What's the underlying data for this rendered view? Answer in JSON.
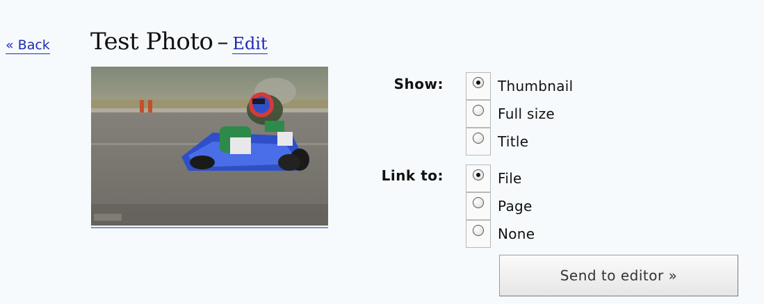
{
  "nav": {
    "back_label": "« Back"
  },
  "header": {
    "title": "Test Photo",
    "separator": "–",
    "edit_label": "Edit"
  },
  "photo": {
    "icon": "go-kart-photo"
  },
  "show": {
    "label": "Show:",
    "options": [
      {
        "label": "Thumbnail",
        "checked": true
      },
      {
        "label": "Full size",
        "checked": false
      },
      {
        "label": "Title",
        "checked": false
      }
    ]
  },
  "link_to": {
    "label": "Link to:",
    "options": [
      {
        "label": "File",
        "checked": true
      },
      {
        "label": "Page",
        "checked": false
      },
      {
        "label": "None",
        "checked": false
      }
    ]
  },
  "actions": {
    "send_label": "Send to editor »"
  }
}
